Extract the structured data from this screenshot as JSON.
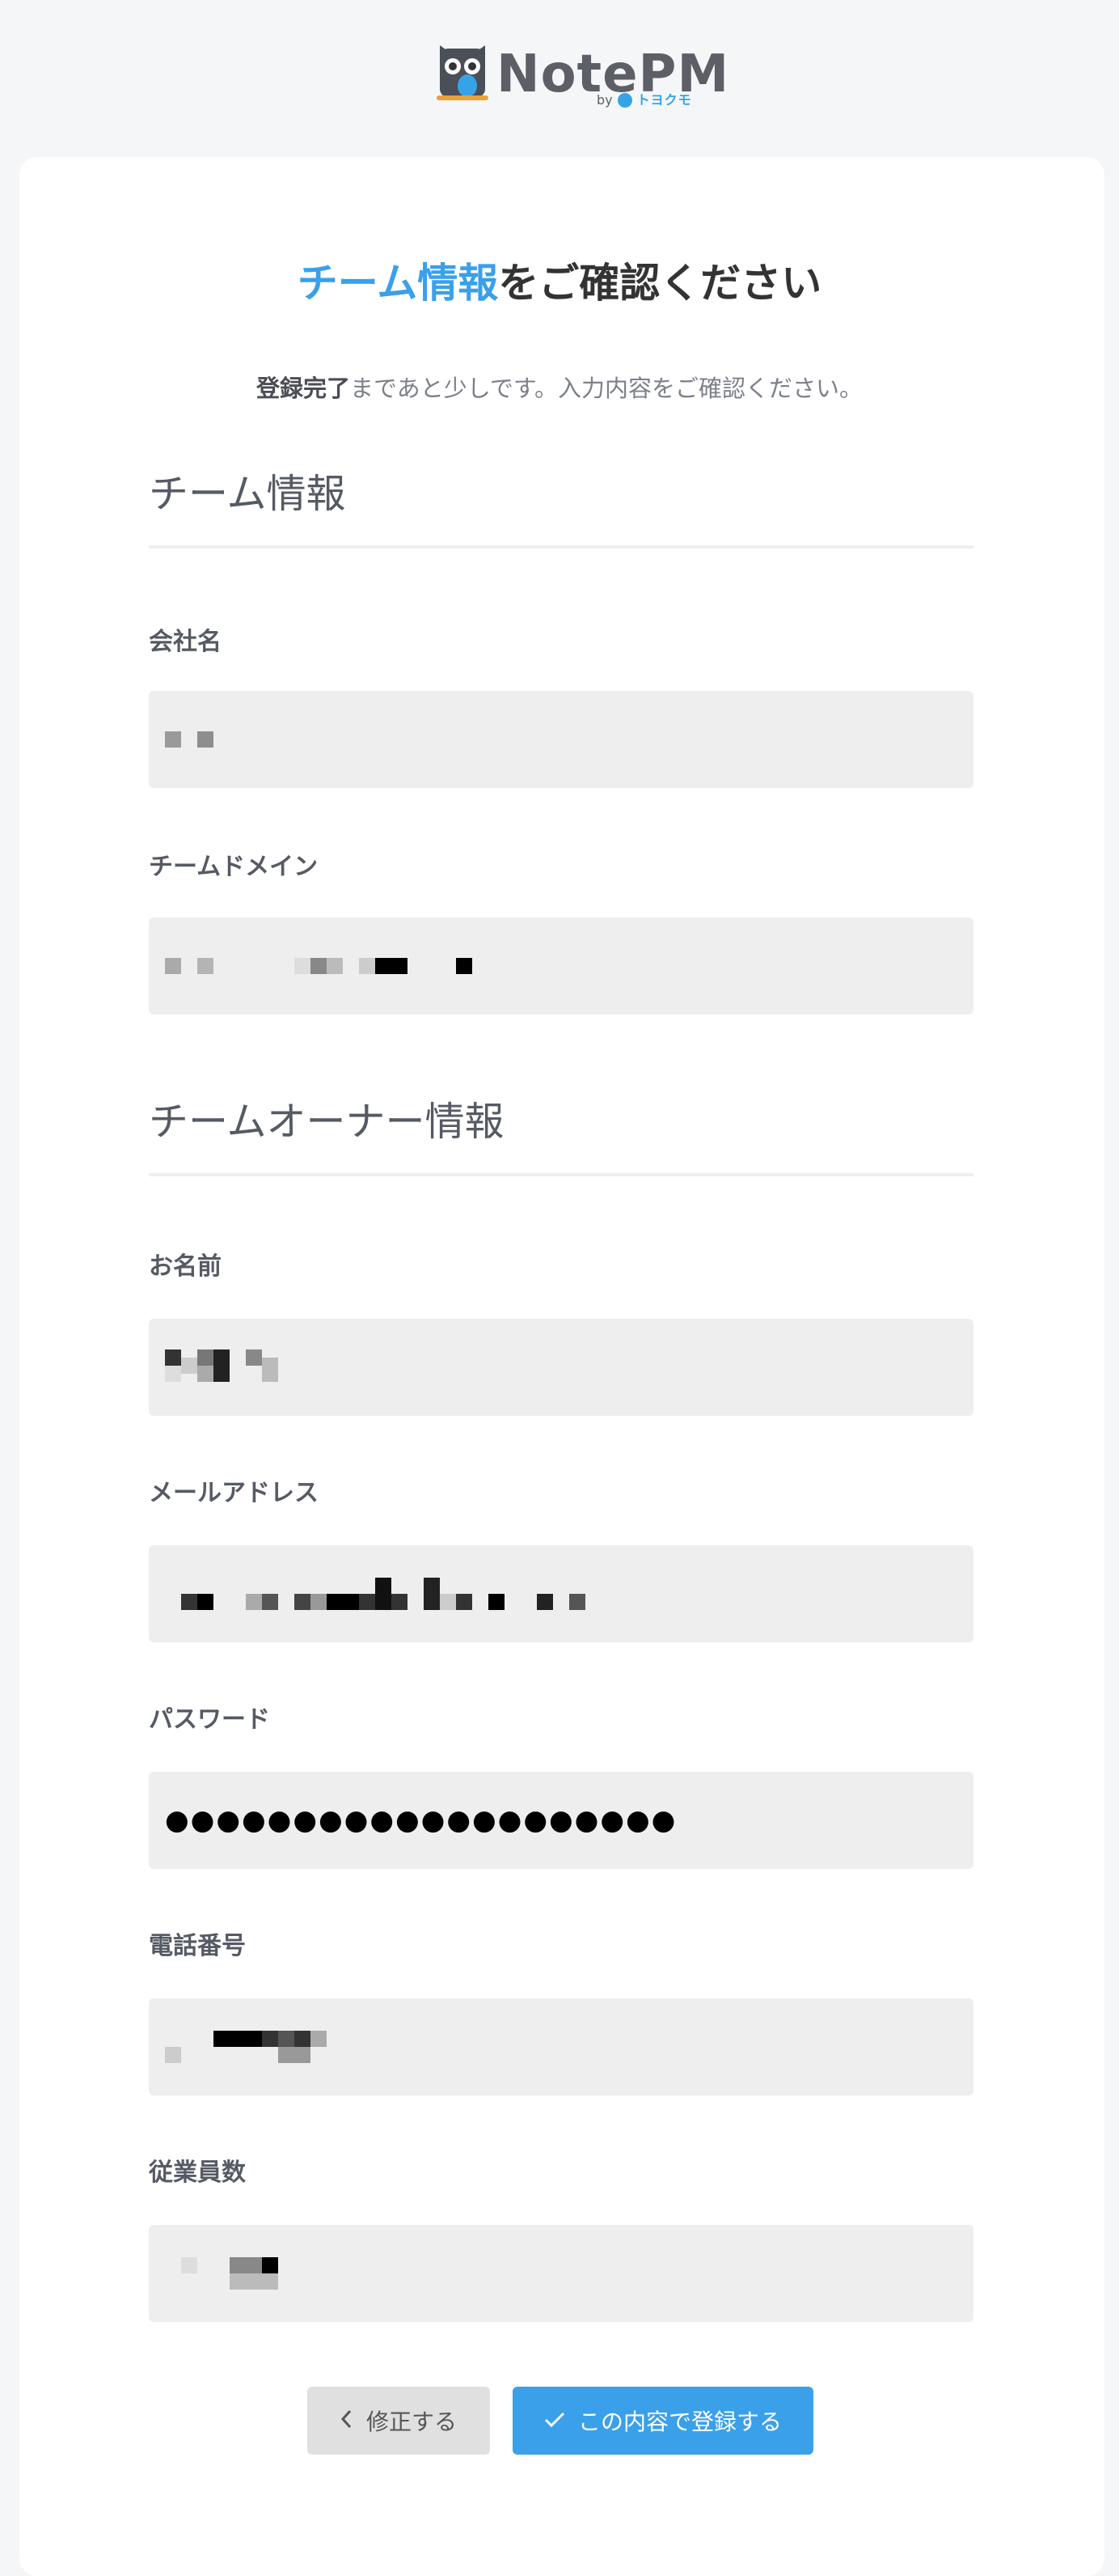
{
  "logo": {
    "name": "NotePM",
    "by": "by",
    "brand": "トヨクモ"
  },
  "page_title": {
    "accent": "チーム情報",
    "rest": "をご確認ください"
  },
  "subtitle": {
    "strong": "登録完了",
    "rest": "まであと少しです。入力内容をご確認ください。"
  },
  "sections": {
    "team": {
      "title": "チーム情報"
    },
    "owner": {
      "title": "チームオーナー情報"
    }
  },
  "fields": {
    "company": {
      "label": "会社名"
    },
    "domain": {
      "label": "チームドメイン"
    },
    "name": {
      "label": "お名前"
    },
    "email": {
      "label": "メールアドレス"
    },
    "password": {
      "label": "パスワード",
      "value": "●●●●●●●●●●●●●●●●●●●●"
    },
    "phone": {
      "label": "電話番号"
    },
    "employees": {
      "label": "従業員数"
    }
  },
  "buttons": {
    "back": {
      "label": "修正する",
      "icon": "chevron-left-icon"
    },
    "submit": {
      "label": "この内容で登録する",
      "icon": "check-icon"
    }
  },
  "colors": {
    "accent": "#3aa0ea",
    "background": "#f5f6f8",
    "card": "#ffffff",
    "field": "#eeeeee"
  }
}
